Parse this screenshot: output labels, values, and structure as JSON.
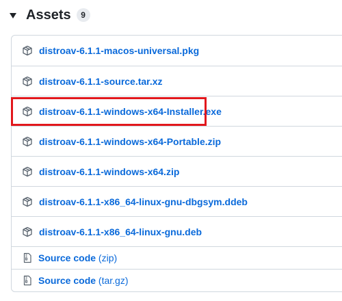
{
  "header": {
    "title": "Assets",
    "count": "9"
  },
  "assets": [
    {
      "name": "distroav-6.1.1-macos-universal.pkg"
    },
    {
      "name": "distroav-6.1.1-source.tar.xz"
    },
    {
      "name": "distroav-6.1.1-windows-x64-Installer.exe"
    },
    {
      "name": "distroav-6.1.1-windows-x64-Portable.zip"
    },
    {
      "name": "distroav-6.1.1-windows-x64.zip"
    },
    {
      "name": "distroav-6.1.1-x86_64-linux-gnu-dbgsym.ddeb"
    },
    {
      "name": "distroav-6.1.1-x86_64-linux-gnu.deb"
    }
  ],
  "source_code": [
    {
      "label": "Source code",
      "format": "(zip)"
    },
    {
      "label": "Source code",
      "format": "(tar.gz)"
    }
  ],
  "colors": {
    "link": "#0969da",
    "highlight": "#e2171c",
    "border": "#d0d7de"
  },
  "icons": {
    "package": "package-icon",
    "file_zip": "file-zip-icon"
  }
}
